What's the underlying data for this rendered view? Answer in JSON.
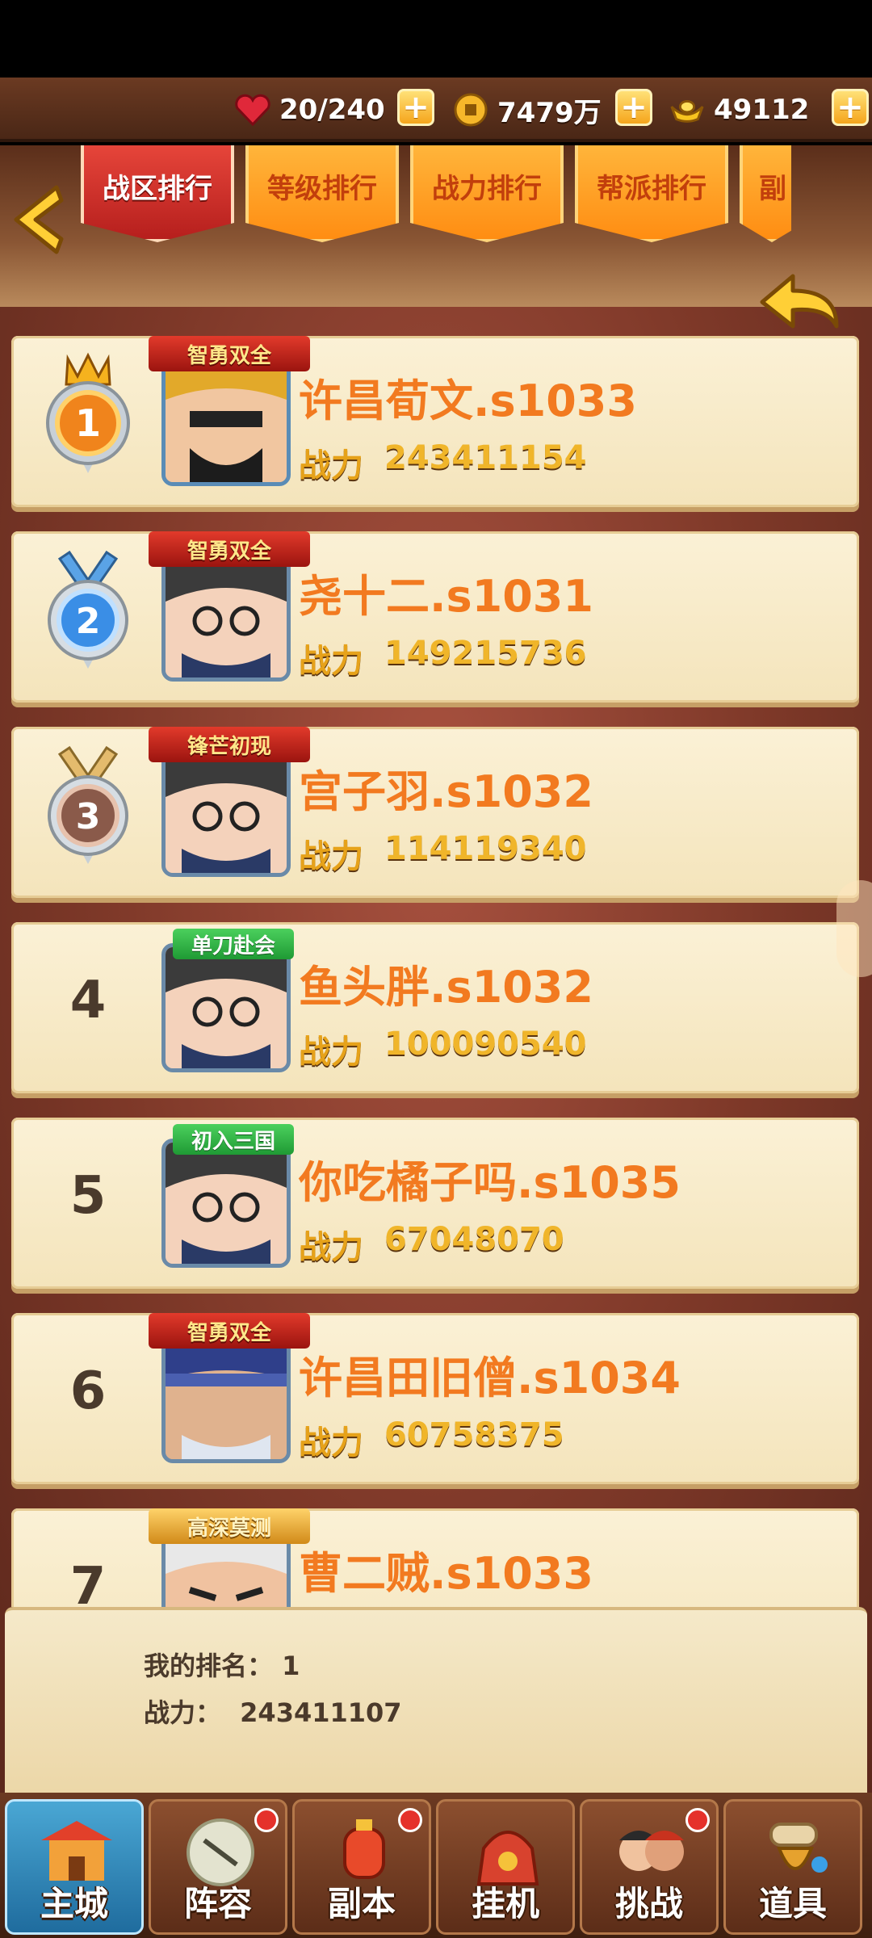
{
  "resources": [
    {
      "icon": "heart-stamina-icon",
      "value": "20/240"
    },
    {
      "icon": "copper-coin-icon",
      "value": "7479万"
    },
    {
      "icon": "gold-ingot-icon",
      "value": "49112"
    }
  ],
  "tabs": [
    {
      "label": "战区排行",
      "active": true
    },
    {
      "label": "等级排行",
      "active": false
    },
    {
      "label": "战力排行",
      "active": false
    },
    {
      "label": "帮派排行",
      "active": false
    },
    {
      "label": "副",
      "active": false
    }
  ],
  "power_label": "战力",
  "rankings": [
    {
      "rank": "1",
      "name": "许昌荀文.s1033",
      "power": "243411154",
      "title": "智勇双全",
      "title_style": "red"
    },
    {
      "rank": "2",
      "name": "尧十二.s1031",
      "power": "149215736",
      "title": "智勇双全",
      "title_style": "red"
    },
    {
      "rank": "3",
      "name": "宫子羽.s1032",
      "power": "114119340",
      "title": "锋芒初现",
      "title_style": "red"
    },
    {
      "rank": "4",
      "name": "鱼头胖.s1032",
      "power": "100090540",
      "title": "单刀赴会",
      "title_style": "green"
    },
    {
      "rank": "5",
      "name": "你吃橘子吗.s1035",
      "power": "67048070",
      "title": "初入三国",
      "title_style": "green"
    },
    {
      "rank": "6",
      "name": "许昌田旧僧.s1034",
      "power": "60758375",
      "title": "智勇双全",
      "title_style": "red"
    },
    {
      "rank": "7",
      "name": "曹二贼.s1033",
      "power": "",
      "title": "高深莫测",
      "title_style": "gold"
    }
  ],
  "my_rank": {
    "rank_label": "我的排名：",
    "rank_value": "1",
    "power_label": "战力：",
    "power_value": "243411107"
  },
  "nav": [
    {
      "label": "主城",
      "icon": "city-gate-icon",
      "active": true,
      "badge": false
    },
    {
      "label": "阵容",
      "icon": "lineup-fan-icon",
      "active": false,
      "badge": true
    },
    {
      "label": "副本",
      "icon": "dungeon-lantern-icon",
      "active": false,
      "badge": true
    },
    {
      "label": "挂机",
      "icon": "idle-bag-icon",
      "active": false,
      "badge": false
    },
    {
      "label": "挑战",
      "icon": "challenge-heroes-icon",
      "active": false,
      "badge": true
    },
    {
      "label": "道具",
      "icon": "items-scroll-icon",
      "active": false,
      "badge": false
    }
  ],
  "colors": {
    "accent_orange": "#f27a20",
    "tab_active": "#b61f1d",
    "badge_red": "#e5312b"
  }
}
